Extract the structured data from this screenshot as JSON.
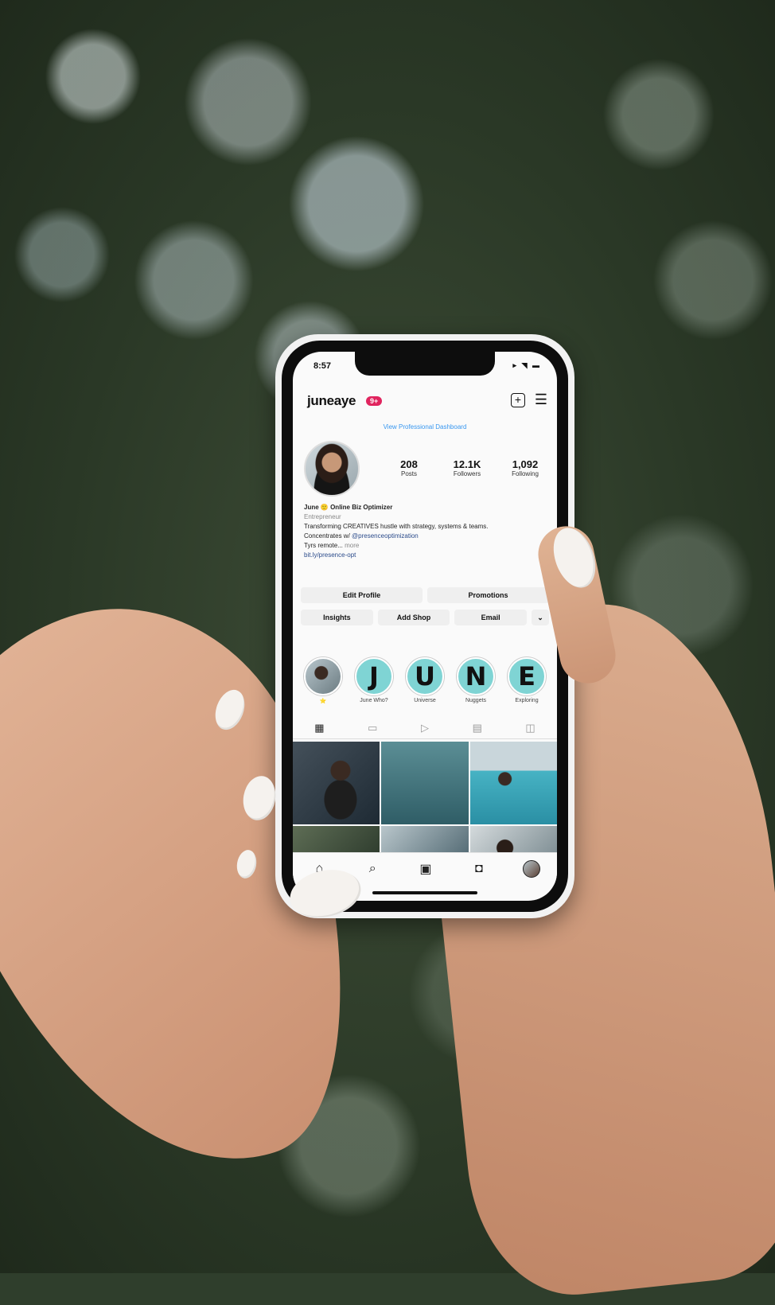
{
  "status_bar": {
    "time": "8:57",
    "system_icons": "▸ ◥ ▬"
  },
  "profile": {
    "username": "juneaye",
    "notification_count": "9+",
    "dashboard_link": "View Professional Dashboard",
    "stats": [
      {
        "value": "208",
        "label": "Posts"
      },
      {
        "value": "12.1K",
        "label": "Followers"
      },
      {
        "value": "1,092",
        "label": "Following"
      }
    ],
    "bio": {
      "name": "June 🙂 Online Biz Optimizer",
      "category": "Entrepreneur",
      "line1": "Transforming CREATIVES hustle with strategy, systems & teams.",
      "line2_prefix": "Concentrates w/ ",
      "line2_link": "@presenceoptimization",
      "line3": "Tyrs remote...",
      "line3_more": "more",
      "website": "bit.ly/presence-opt"
    }
  },
  "buttons": {
    "row1": [
      "Edit Profile",
      "Promotions"
    ],
    "row2": [
      "Insights",
      "Add Shop",
      "Email"
    ],
    "dropdown": "⌄"
  },
  "highlights": [
    {
      "letter": "",
      "label": "⭐"
    },
    {
      "letter": "J",
      "label": "June Who?"
    },
    {
      "letter": "U",
      "label": "Universe"
    },
    {
      "letter": "N",
      "label": "Nuggets"
    },
    {
      "letter": "E",
      "label": "Exploring"
    }
  ],
  "tabs": [
    "grid-icon",
    "reels-icon",
    "video-icon",
    "guides-icon",
    "tagged-icon"
  ],
  "bottom_nav": [
    "home-icon",
    "search-icon",
    "reels-icon",
    "shop-icon",
    "profile-icon"
  ],
  "colors": {
    "highlight_teal": "#7fd4d4",
    "badge_red": "#e0245e",
    "link_blue": "#3897f0"
  }
}
